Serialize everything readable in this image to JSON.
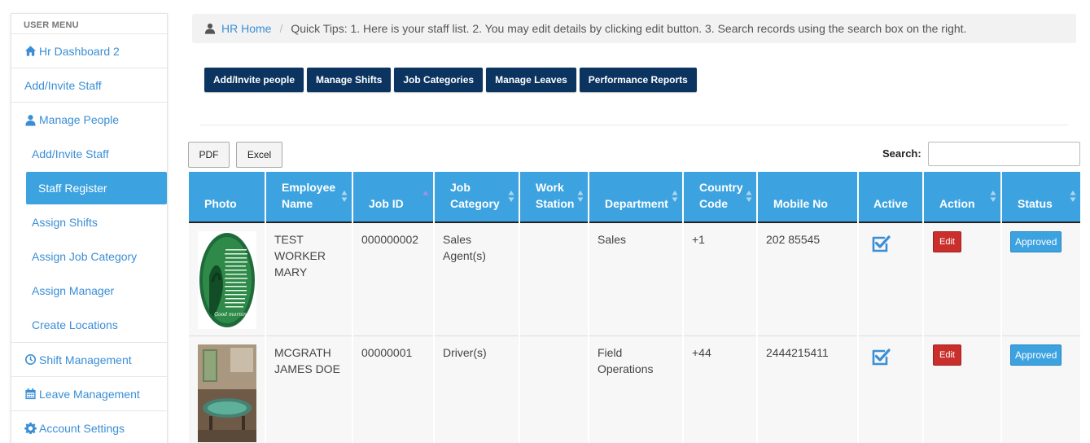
{
  "sidebar": {
    "header": "USER MENU",
    "items": [
      {
        "label": "Hr Dashboard 2",
        "icon": "home-icon"
      },
      {
        "label": "Add/Invite Staff",
        "icon": ""
      },
      {
        "label": "Manage People",
        "icon": "user-icon"
      }
    ],
    "sub_items": [
      {
        "label": "Add/Invite Staff"
      },
      {
        "label": "Staff Register",
        "active": true
      },
      {
        "label": "Assign Shifts"
      },
      {
        "label": "Assign Job Category"
      },
      {
        "label": "Assign Manager"
      },
      {
        "label": "Create Locations"
      }
    ],
    "bottom_items": [
      {
        "label": "Shift Management",
        "icon": "clock-icon"
      },
      {
        "label": "Leave Management",
        "icon": "calendar-icon"
      },
      {
        "label": "Account Settings",
        "icon": "gear-icon"
      }
    ]
  },
  "breadcrumb": {
    "home": "HR Home",
    "separator": "/",
    "tips": "Quick Tips: 1. Here is your staff list. 2. You may edit details by clicking edit button. 3. Search records using the search box on the right."
  },
  "toolbar": {
    "buttons": [
      "Add/Invite people",
      "Manage Shifts",
      "Job Categories",
      "Manage Leaves",
      "Performance Reports"
    ]
  },
  "export": {
    "pdf": "PDF",
    "excel": "Excel"
  },
  "search": {
    "label": "Search:",
    "value": ""
  },
  "table": {
    "columns": [
      {
        "line1": "Photo",
        "line2": ""
      },
      {
        "line1": "Employee",
        "line2": "Name"
      },
      {
        "line1": "Job ID",
        "line2": ""
      },
      {
        "line1": "Job",
        "line2": "Category"
      },
      {
        "line1": "Work",
        "line2": "Station"
      },
      {
        "line1": "Department",
        "line2": ""
      },
      {
        "line1": "Country",
        "line2": "Code"
      },
      {
        "line1": "Mobile No",
        "line2": ""
      },
      {
        "line1": "Active",
        "line2": ""
      },
      {
        "line1": "Action",
        "line2": ""
      },
      {
        "line1": "Status",
        "line2": ""
      }
    ],
    "rows": [
      {
        "name": "TEST WORKER MARY",
        "job_id": "000000002",
        "job_category": "Sales Agent(s)",
        "work_station": "",
        "department": "Sales",
        "country_code": "+1",
        "mobile": "202 85545",
        "action": "Edit",
        "status": "Approved",
        "photo_text": "Good morning"
      },
      {
        "name": "MCGRATH JAMES DOE",
        "job_id": "00000001",
        "job_category": "Driver(s)",
        "work_station": "",
        "department": "Field Operations",
        "country_code": "+44",
        "mobile": "2444215411",
        "action": "Edit",
        "status": "Approved"
      }
    ]
  },
  "colors": {
    "accent": "#3da3e0",
    "link": "#3a8ed6",
    "dark_button": "#0b3460",
    "danger": "#c9302c"
  }
}
